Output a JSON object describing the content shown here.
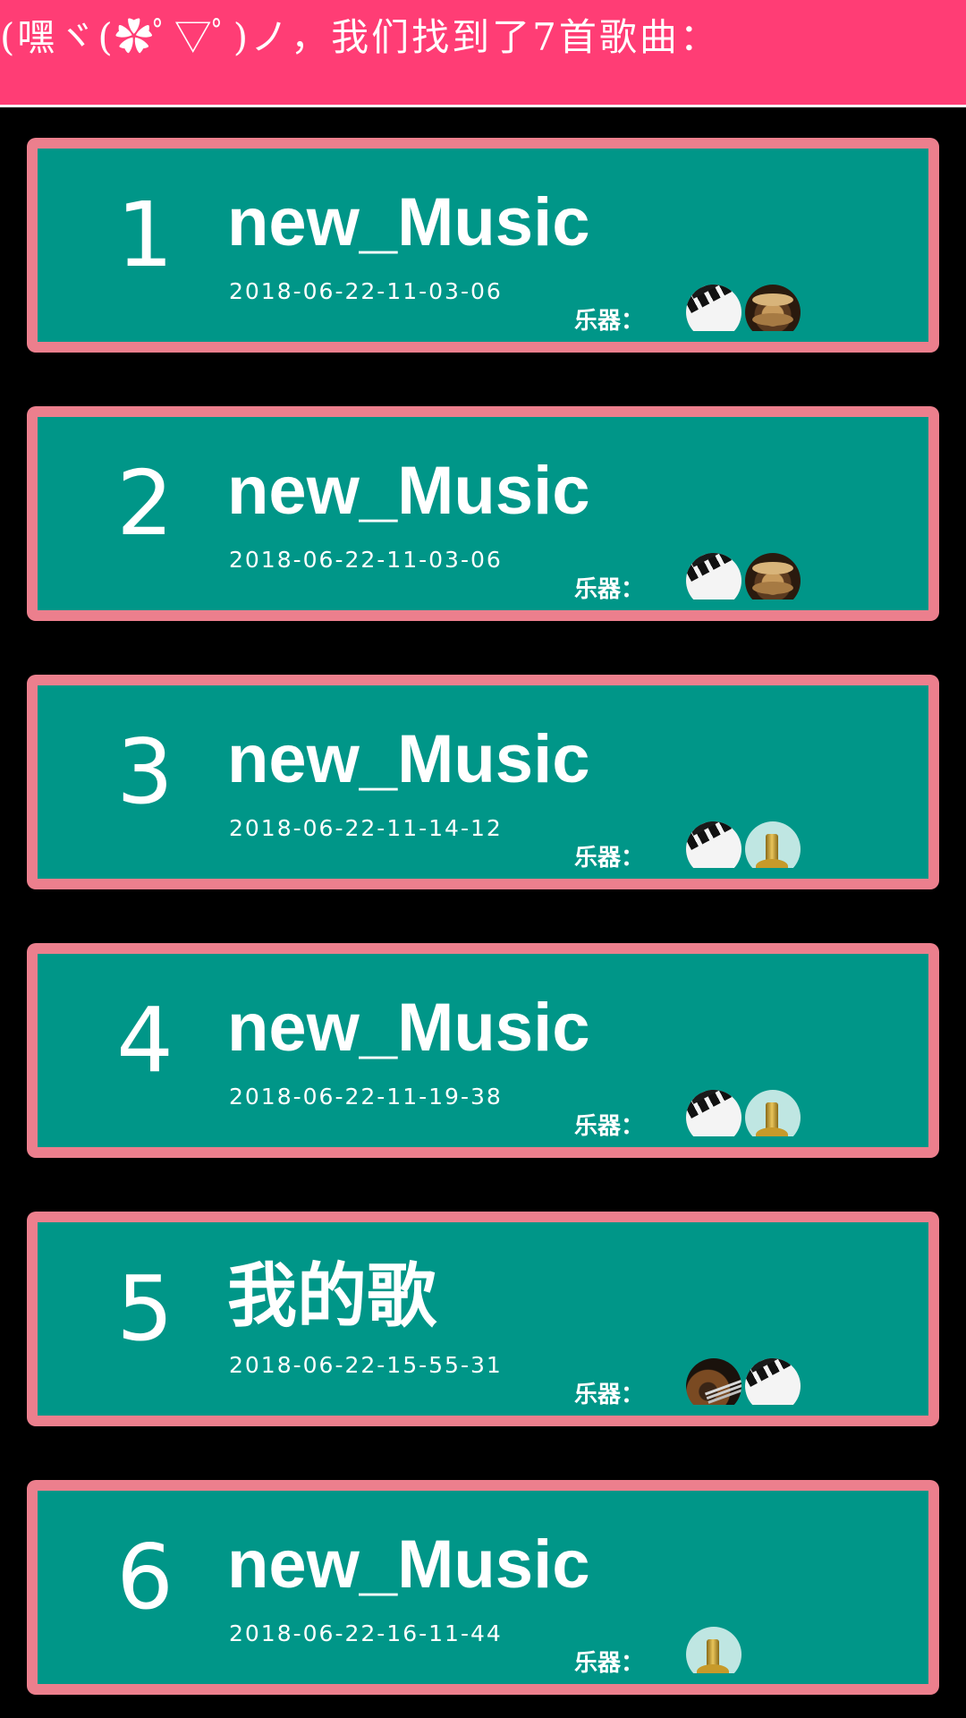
{
  "header": {
    "text": "(嘿ヾ(✿ﾟ▽ﾟ)ノ，我们找到了7首歌曲：",
    "background": "#ff3d75"
  },
  "colors": {
    "card_bg": "#009688",
    "card_border": "#ec7f8d",
    "page_bg": "#000000"
  },
  "instrument_label": "乐器：",
  "songs": [
    {
      "index": "1",
      "title": "new_Music",
      "date": "2018-06-22-11-03-06",
      "instruments": [
        "piano-icon",
        "drum-icon"
      ]
    },
    {
      "index": "2",
      "title": "new_Music",
      "date": "2018-06-22-11-03-06",
      "instruments": [
        "piano-icon",
        "drum-icon"
      ]
    },
    {
      "index": "3",
      "title": "new_Music",
      "date": "2018-06-22-11-14-12",
      "instruments": [
        "piano-icon",
        "bell-icon"
      ]
    },
    {
      "index": "4",
      "title": "new_Music",
      "date": "2018-06-22-11-19-38",
      "instruments": [
        "piano-icon",
        "bell-icon"
      ]
    },
    {
      "index": "5",
      "title": "我的歌",
      "date": "2018-06-22-15-55-31",
      "instruments": [
        "guitar-icon",
        "piano-icon"
      ]
    },
    {
      "index": "6",
      "title": "new_Music",
      "date": "2018-06-22-16-11-44",
      "instruments": [
        "bell-icon"
      ]
    }
  ]
}
